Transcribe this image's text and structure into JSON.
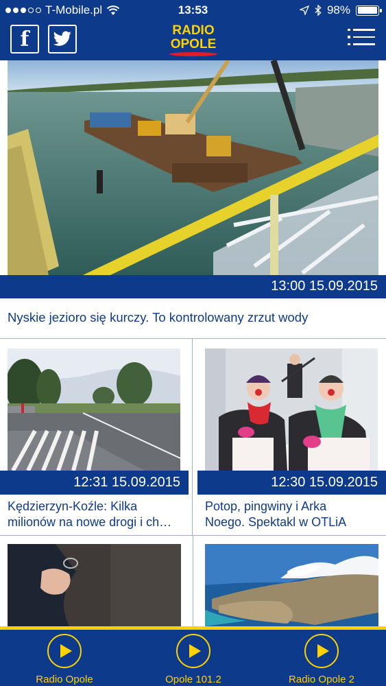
{
  "status_bar": {
    "carrier": "T-Mobile.pl",
    "time": "13:53",
    "battery": "98%",
    "battery_level": 0.98
  },
  "header": {
    "logo_line1": "RADIO",
    "logo_line2": "OPOLE",
    "icons": [
      "facebook-icon",
      "twitter-icon",
      "menu-icon"
    ]
  },
  "featured": {
    "date": "13:00 15.09.2015",
    "title": "Nyskie jezioro się kurczy. To kontrolowany zrzut wody"
  },
  "articles": [
    {
      "date": "12:31 15.09.2015",
      "title_line1": "Kędzierzyn-Koźle: Kilka",
      "title_line2": "milionów na nowe drogi i ch…"
    },
    {
      "date": "12:30 15.09.2015",
      "title_line1": "Potop, pingwiny i Arka",
      "title_line2": "Noego. Spektakl w OTLiA"
    }
  ],
  "player": {
    "stations": [
      {
        "label": "Radio Opole"
      },
      {
        "label": "Opole 101.2"
      },
      {
        "label": "Radio Opole 2"
      }
    ]
  },
  "colors": {
    "brand_blue": "#0e3a8c",
    "brand_yellow": "#ffd200",
    "logo_red": "#e11d2a"
  }
}
